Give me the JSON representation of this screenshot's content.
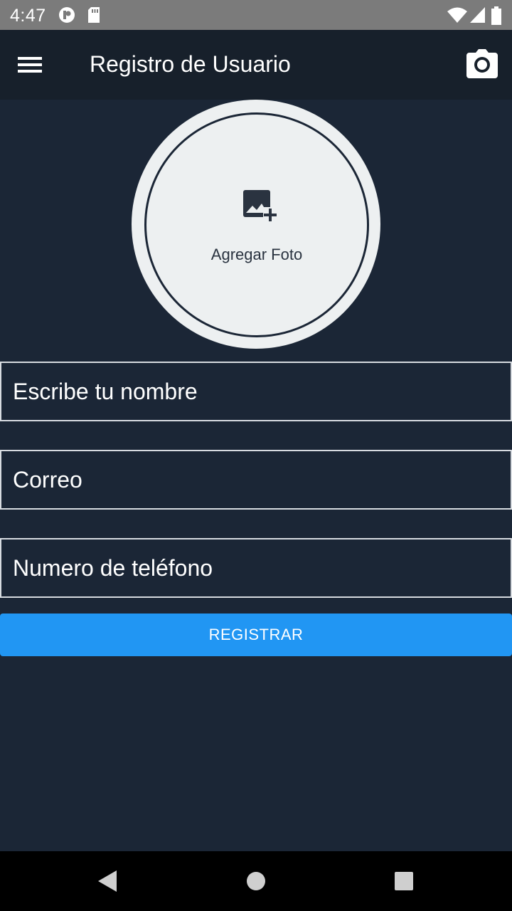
{
  "status_bar": {
    "time": "4:47",
    "icons": [
      "tracking-icon",
      "sd-card-icon",
      "wifi-icon",
      "signal-icon",
      "battery-icon"
    ]
  },
  "app_bar": {
    "title": "Registro de Usuario",
    "left_icon": "menu-icon",
    "right_icon": "camera-icon"
  },
  "photo": {
    "label": "Agregar Foto",
    "icon": "add-photo-icon"
  },
  "form": {
    "name_placeholder": "Escribe tu nombre",
    "email_placeholder": "Correo",
    "phone_placeholder": "Numero de teléfono",
    "submit_label": "REGISTRAR"
  },
  "nav_bar": {
    "icons": [
      "back-icon",
      "home-icon",
      "recents-icon"
    ]
  },
  "colors": {
    "background": "#1b2636",
    "app_bar": "#17202b",
    "accent": "#2196f3",
    "photo_bg": "#edf0f1"
  }
}
